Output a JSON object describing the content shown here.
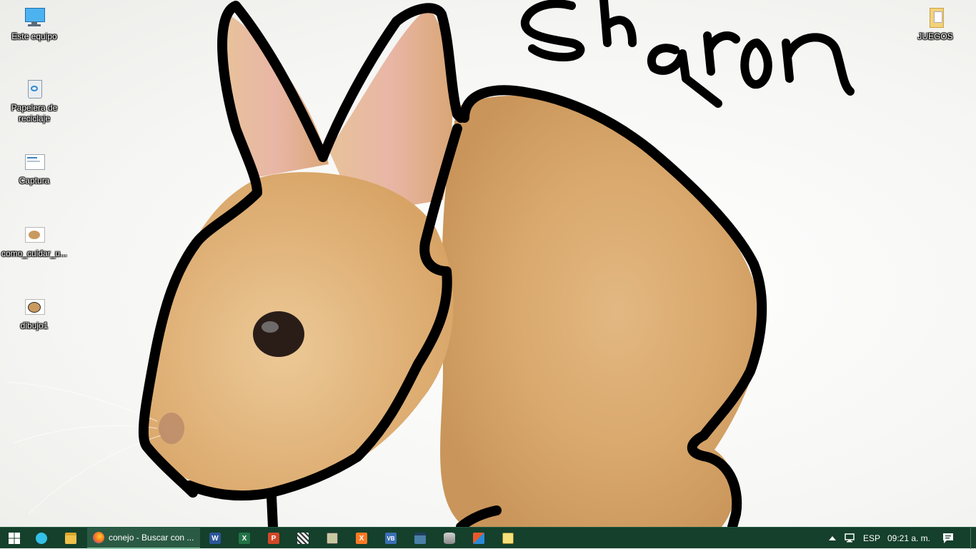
{
  "wallpaper": {
    "handwriting": "Sharon"
  },
  "desktop_icons": [
    {
      "label": "Este equipo",
      "icon": "computer-icon"
    },
    {
      "label": "Papelera de reciclaje",
      "icon": "recycle-bin-icon"
    },
    {
      "label": "Captura",
      "icon": "screenshot-file-icon"
    },
    {
      "label": "como_cuidar_u...",
      "icon": "bunny-image-icon"
    },
    {
      "label": "dibujo1",
      "icon": "bunny-image-icon"
    },
    {
      "label": "JUEGOS",
      "icon": "folder-icon"
    }
  ],
  "taskbar": {
    "start_icon": "windows-start-icon",
    "pinned": [
      {
        "name": "edge-icon",
        "color": "#35c0e8"
      },
      {
        "name": "file-explorer-icon",
        "color": "#f0c14b"
      }
    ],
    "active_window": {
      "icon": "firefox-icon",
      "title": "conejo - Buscar con ..."
    },
    "apps": [
      {
        "name": "word-icon",
        "color": "#2b579a",
        "letter": "W"
      },
      {
        "name": "excel-icon",
        "color": "#217346",
        "letter": "X"
      },
      {
        "name": "powerpoint-icon",
        "color": "#d24726",
        "letter": "P"
      },
      {
        "name": "snipping-icon",
        "color": "#d8d8d8",
        "letter": ""
      },
      {
        "name": "app-icon",
        "color": "#c9c9a0",
        "letter": ""
      },
      {
        "name": "xampp-icon",
        "color": "#fb7a24",
        "letter": "X"
      },
      {
        "name": "visual-basic-icon",
        "color": "#3a6fb5",
        "letter": "VB"
      },
      {
        "name": "workbench-icon",
        "color": "#4a7fa8",
        "letter": ""
      },
      {
        "name": "database-icon",
        "color": "#b0b0b0",
        "letter": ""
      },
      {
        "name": "paint-icon",
        "color": "#e85a2a",
        "letter": ""
      },
      {
        "name": "notepad-icon",
        "color": "#f5e07a",
        "letter": ""
      }
    ],
    "tray": {
      "language": "ESP",
      "time": "09:21 a. m."
    }
  }
}
